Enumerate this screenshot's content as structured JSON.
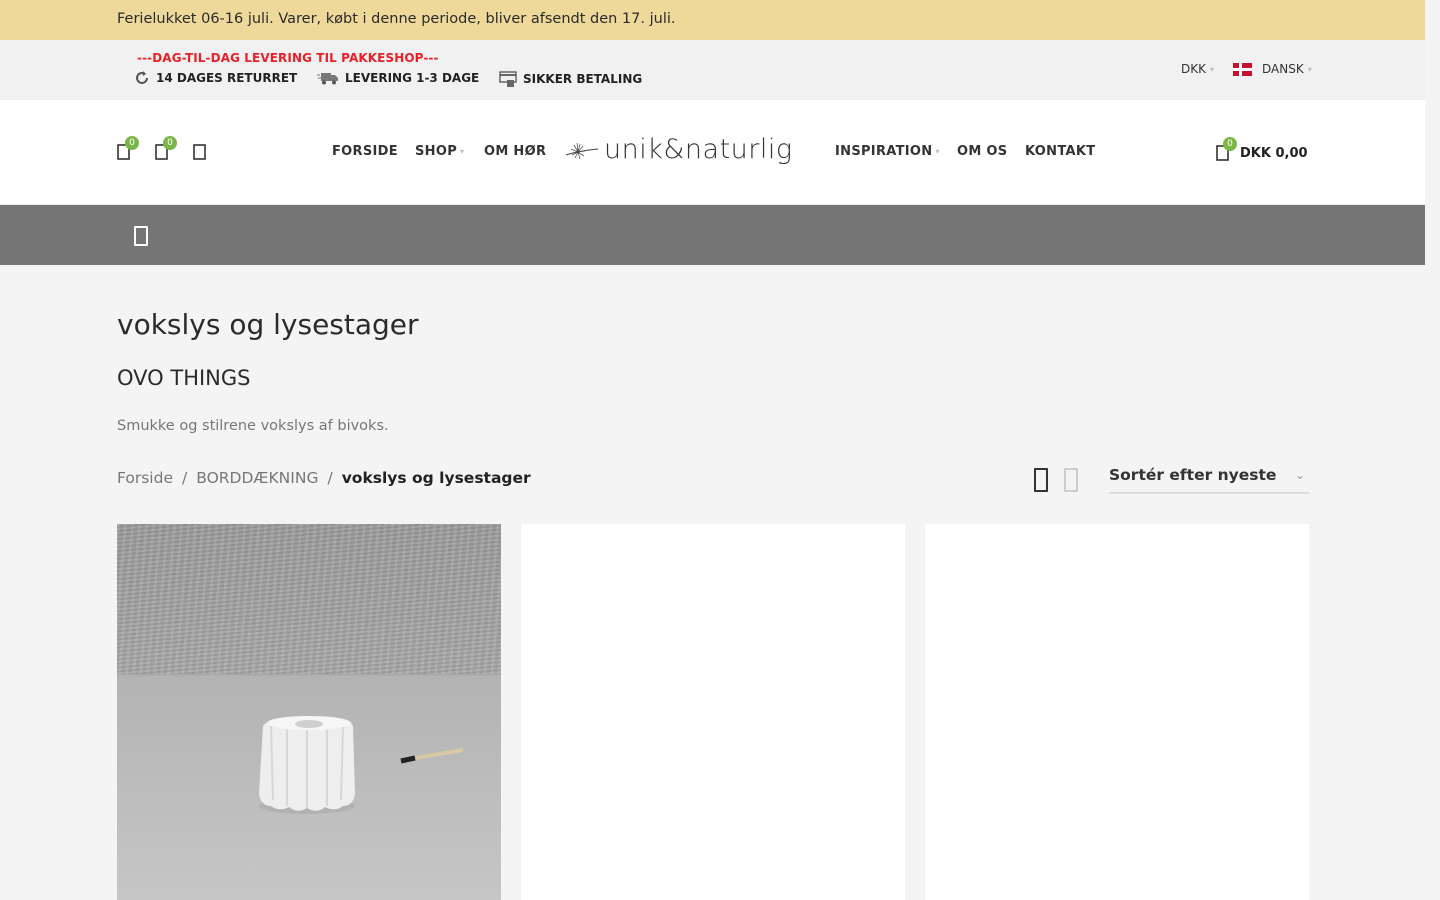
{
  "announcement": "Ferielukket 06-16 juli. Varer, købt i denne periode, bliver afsendt den 17. juli.",
  "topbar": {
    "promo": "---DAG-TIL-DAG LEVERING TIL PAKKESHOP---",
    "features": [
      {
        "icon": "refresh-icon",
        "label": "14 DAGES RETURRET"
      },
      {
        "icon": "truck-icon",
        "label": "LEVERING 1-3 DAGE"
      },
      {
        "icon": "secure-payment-icon",
        "label": "SIKKER BETALING"
      }
    ],
    "currency": "DKK",
    "language": "DANSK"
  },
  "header": {
    "wishlist_count": "0",
    "compare_count": "0",
    "nav_left": [
      "FORSIDE",
      "SHOP",
      "OM HØR"
    ],
    "nav_right": [
      "INSPIRATION",
      "OM OS",
      "KONTAKT"
    ],
    "logo_text": "unik&naturlig",
    "cart_count": "0",
    "cart_total": "DKK 0,00"
  },
  "page": {
    "title": "vokslys og lysestager",
    "brand": "OVO THINGS",
    "description": "Smukke og stilrene vokslys af bivoks.",
    "breadcrumb": [
      "Forside",
      "BORDDÆKNING",
      "vokslys og lysestager"
    ],
    "sort_label": "Sortér efter nyeste"
  },
  "colors": {
    "announcement_bg": "#efd99a",
    "promo_red": "#e8202a",
    "badge_green": "#7ab648",
    "graybar": "#757575"
  }
}
